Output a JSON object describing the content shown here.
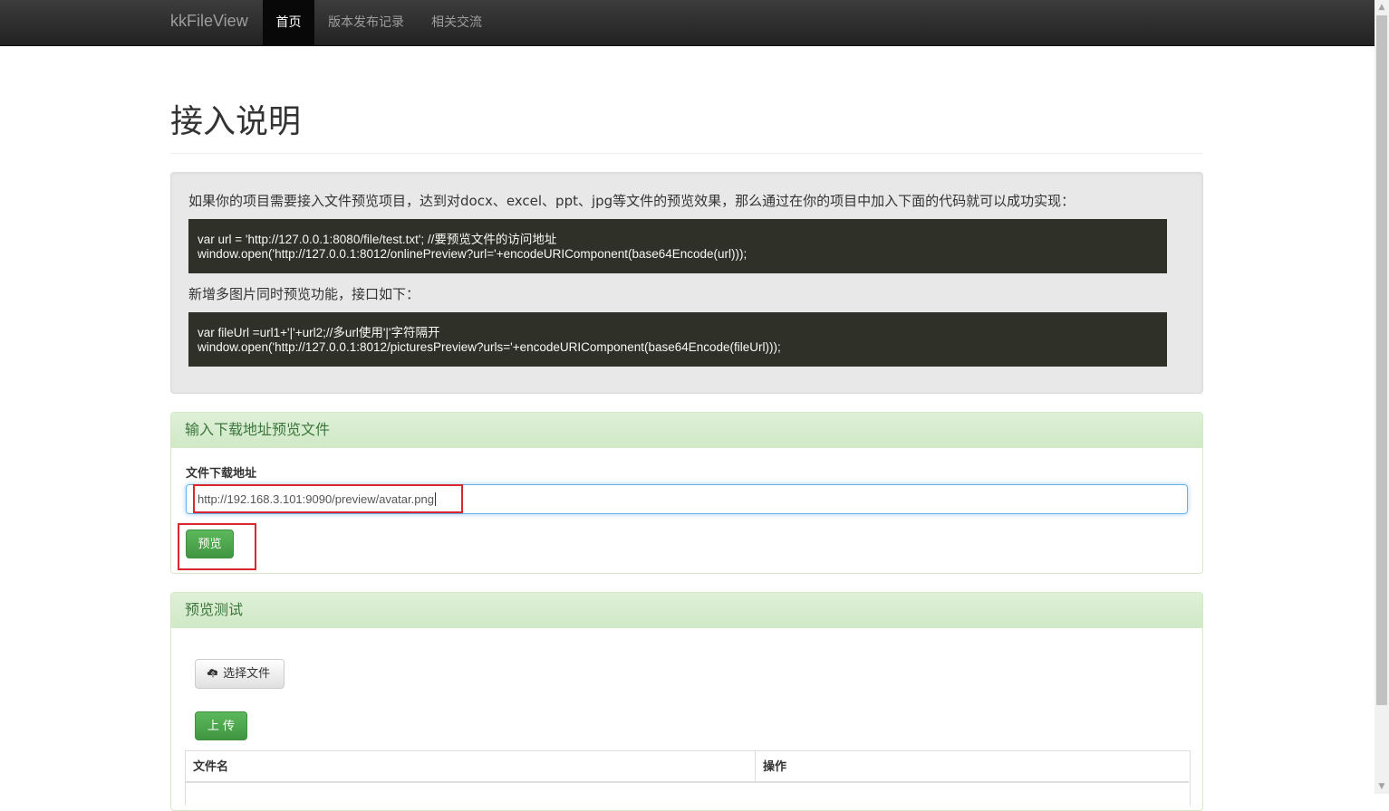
{
  "navbar": {
    "brand": "kkFileView",
    "items": [
      "首页",
      "版本发布记录",
      "相关交流"
    ]
  },
  "page": {
    "title": "接入说明"
  },
  "instructions": {
    "intro": "如果你的项目需要接入文件预览项目，达到对docx、excel、ppt、jpg等文件的预览效果，那么通过在你的项目中加入下面的代码就可以成功实现：",
    "code1": [
      "var url = 'http://127.0.0.1:8080/file/test.txt'; //要预览文件的访问地址",
      "window.open('http://127.0.0.1:8012/onlinePreview?url='+encodeURIComponent(base64Encode(url)));"
    ],
    "multi_intro": "新增多图片同时预览功能，接口如下：",
    "code2": [
      "var fileUrl =url1+'|'+url2;//多url使用'|'字符隔开",
      "window.open('http://127.0.0.1:8012/picturesPreview?urls='+encodeURIComponent(base64Encode(fileUrl)));"
    ]
  },
  "url_panel": {
    "heading": "输入下载地址预览文件",
    "field_label": "文件下载地址",
    "field_value": "http://192.168.3.101:9090/preview/avatar.png",
    "preview_button": "预览"
  },
  "test_panel": {
    "heading": "预览测试",
    "choose_file_button": "选择文件",
    "upload_button": "上 传",
    "table_headers": [
      "文件名",
      "操作"
    ]
  },
  "colors": {
    "navbar": "#222222",
    "success": "#5cb85c",
    "highlight": "#d9262f",
    "code_bg": "#2f3129"
  }
}
